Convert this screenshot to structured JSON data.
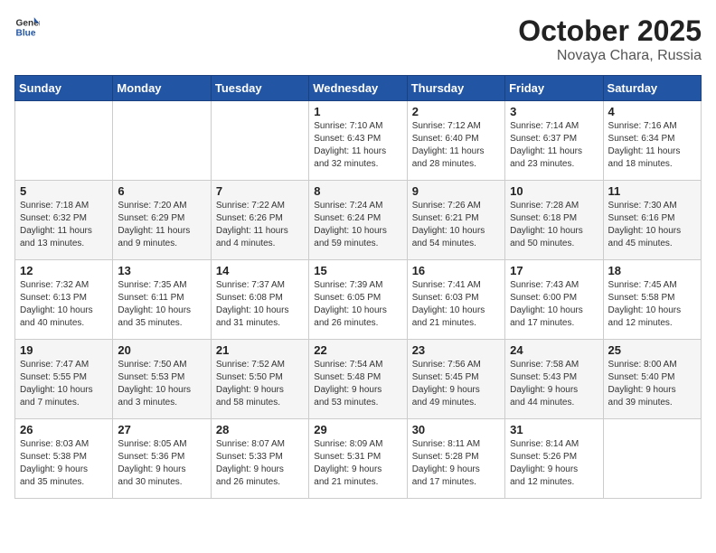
{
  "header": {
    "logo_general": "General",
    "logo_blue": "Blue",
    "title": "October 2025",
    "location": "Novaya Chara, Russia"
  },
  "days_of_week": [
    "Sunday",
    "Monday",
    "Tuesday",
    "Wednesday",
    "Thursday",
    "Friday",
    "Saturday"
  ],
  "weeks": [
    [
      {
        "day": "",
        "info": ""
      },
      {
        "day": "",
        "info": ""
      },
      {
        "day": "",
        "info": ""
      },
      {
        "day": "1",
        "info": "Sunrise: 7:10 AM\nSunset: 6:43 PM\nDaylight: 11 hours\nand 32 minutes."
      },
      {
        "day": "2",
        "info": "Sunrise: 7:12 AM\nSunset: 6:40 PM\nDaylight: 11 hours\nand 28 minutes."
      },
      {
        "day": "3",
        "info": "Sunrise: 7:14 AM\nSunset: 6:37 PM\nDaylight: 11 hours\nand 23 minutes."
      },
      {
        "day": "4",
        "info": "Sunrise: 7:16 AM\nSunset: 6:34 PM\nDaylight: 11 hours\nand 18 minutes."
      }
    ],
    [
      {
        "day": "5",
        "info": "Sunrise: 7:18 AM\nSunset: 6:32 PM\nDaylight: 11 hours\nand 13 minutes."
      },
      {
        "day": "6",
        "info": "Sunrise: 7:20 AM\nSunset: 6:29 PM\nDaylight: 11 hours\nand 9 minutes."
      },
      {
        "day": "7",
        "info": "Sunrise: 7:22 AM\nSunset: 6:26 PM\nDaylight: 11 hours\nand 4 minutes."
      },
      {
        "day": "8",
        "info": "Sunrise: 7:24 AM\nSunset: 6:24 PM\nDaylight: 10 hours\nand 59 minutes."
      },
      {
        "day": "9",
        "info": "Sunrise: 7:26 AM\nSunset: 6:21 PM\nDaylight: 10 hours\nand 54 minutes."
      },
      {
        "day": "10",
        "info": "Sunrise: 7:28 AM\nSunset: 6:18 PM\nDaylight: 10 hours\nand 50 minutes."
      },
      {
        "day": "11",
        "info": "Sunrise: 7:30 AM\nSunset: 6:16 PM\nDaylight: 10 hours\nand 45 minutes."
      }
    ],
    [
      {
        "day": "12",
        "info": "Sunrise: 7:32 AM\nSunset: 6:13 PM\nDaylight: 10 hours\nand 40 minutes."
      },
      {
        "day": "13",
        "info": "Sunrise: 7:35 AM\nSunset: 6:11 PM\nDaylight: 10 hours\nand 35 minutes."
      },
      {
        "day": "14",
        "info": "Sunrise: 7:37 AM\nSunset: 6:08 PM\nDaylight: 10 hours\nand 31 minutes."
      },
      {
        "day": "15",
        "info": "Sunrise: 7:39 AM\nSunset: 6:05 PM\nDaylight: 10 hours\nand 26 minutes."
      },
      {
        "day": "16",
        "info": "Sunrise: 7:41 AM\nSunset: 6:03 PM\nDaylight: 10 hours\nand 21 minutes."
      },
      {
        "day": "17",
        "info": "Sunrise: 7:43 AM\nSunset: 6:00 PM\nDaylight: 10 hours\nand 17 minutes."
      },
      {
        "day": "18",
        "info": "Sunrise: 7:45 AM\nSunset: 5:58 PM\nDaylight: 10 hours\nand 12 minutes."
      }
    ],
    [
      {
        "day": "19",
        "info": "Sunrise: 7:47 AM\nSunset: 5:55 PM\nDaylight: 10 hours\nand 7 minutes."
      },
      {
        "day": "20",
        "info": "Sunrise: 7:50 AM\nSunset: 5:53 PM\nDaylight: 10 hours\nand 3 minutes."
      },
      {
        "day": "21",
        "info": "Sunrise: 7:52 AM\nSunset: 5:50 PM\nDaylight: 9 hours\nand 58 minutes."
      },
      {
        "day": "22",
        "info": "Sunrise: 7:54 AM\nSunset: 5:48 PM\nDaylight: 9 hours\nand 53 minutes."
      },
      {
        "day": "23",
        "info": "Sunrise: 7:56 AM\nSunset: 5:45 PM\nDaylight: 9 hours\nand 49 minutes."
      },
      {
        "day": "24",
        "info": "Sunrise: 7:58 AM\nSunset: 5:43 PM\nDaylight: 9 hours\nand 44 minutes."
      },
      {
        "day": "25",
        "info": "Sunrise: 8:00 AM\nSunset: 5:40 PM\nDaylight: 9 hours\nand 39 minutes."
      }
    ],
    [
      {
        "day": "26",
        "info": "Sunrise: 8:03 AM\nSunset: 5:38 PM\nDaylight: 9 hours\nand 35 minutes."
      },
      {
        "day": "27",
        "info": "Sunrise: 8:05 AM\nSunset: 5:36 PM\nDaylight: 9 hours\nand 30 minutes."
      },
      {
        "day": "28",
        "info": "Sunrise: 8:07 AM\nSunset: 5:33 PM\nDaylight: 9 hours\nand 26 minutes."
      },
      {
        "day": "29",
        "info": "Sunrise: 8:09 AM\nSunset: 5:31 PM\nDaylight: 9 hours\nand 21 minutes."
      },
      {
        "day": "30",
        "info": "Sunrise: 8:11 AM\nSunset: 5:28 PM\nDaylight: 9 hours\nand 17 minutes."
      },
      {
        "day": "31",
        "info": "Sunrise: 8:14 AM\nSunset: 5:26 PM\nDaylight: 9 hours\nand 12 minutes."
      },
      {
        "day": "",
        "info": ""
      }
    ]
  ]
}
